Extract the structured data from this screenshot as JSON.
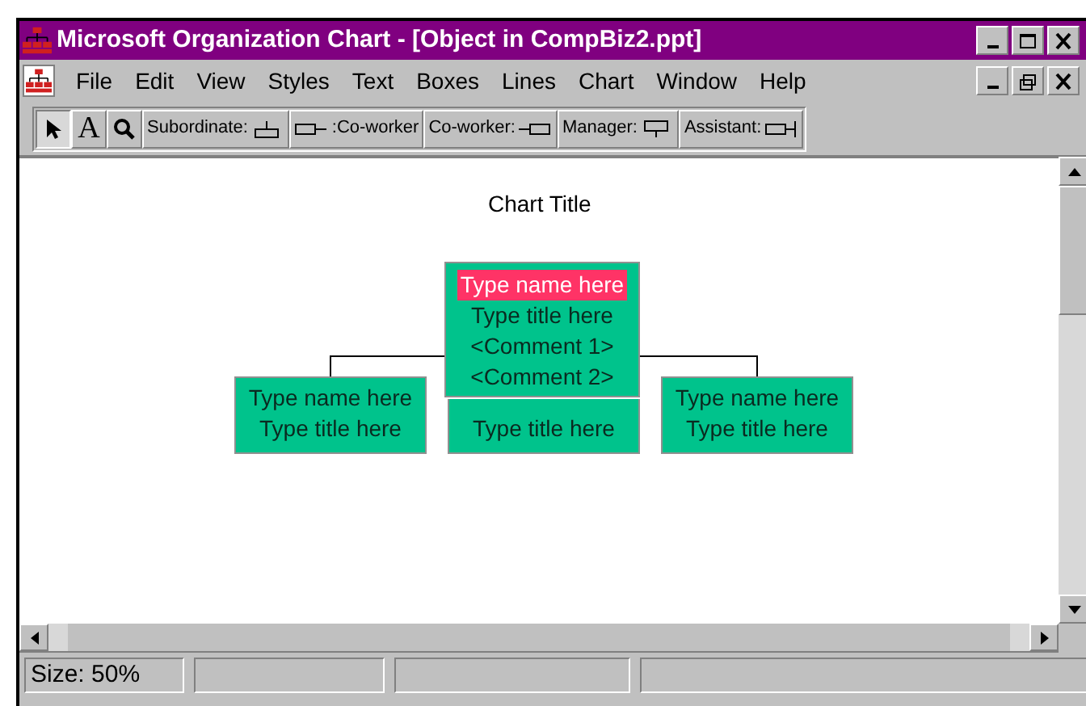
{
  "window": {
    "title": "Microsoft Organization Chart - [Object in CompBiz2.ppt]"
  },
  "menu": [
    "File",
    "Edit",
    "View",
    "Styles",
    "Text",
    "Boxes",
    "Lines",
    "Chart",
    "Window",
    "Help"
  ],
  "tools": [
    {
      "kind": "pointer",
      "selected": true
    },
    {
      "kind": "text",
      "glyph": "A",
      "selected": false
    },
    {
      "kind": "zoom",
      "selected": false
    }
  ],
  "box_tools": [
    {
      "kind": "subordinate",
      "label": "Subordinate:"
    },
    {
      "kind": "coworker_left",
      "label": ":Co-worker"
    },
    {
      "kind": "coworker_right",
      "label": "Co-worker:"
    },
    {
      "kind": "manager",
      "label": "Manager:"
    },
    {
      "kind": "assistant",
      "label": "Assistant:"
    }
  ],
  "chart": {
    "title": "Chart Title",
    "manager": {
      "name": "Type name here",
      "name_selected": true,
      "title": "Type title here",
      "comment_1": "<Comment 1>",
      "comment_2": "<Comment 2>"
    },
    "subordinates": [
      {
        "name": "Type name here",
        "title": "Type title here"
      },
      {
        "title": "Type title here"
      },
      {
        "name": "Type name here",
        "title": "Type title here"
      }
    ]
  },
  "status_bar": {
    "size": "Size: 50%"
  }
}
